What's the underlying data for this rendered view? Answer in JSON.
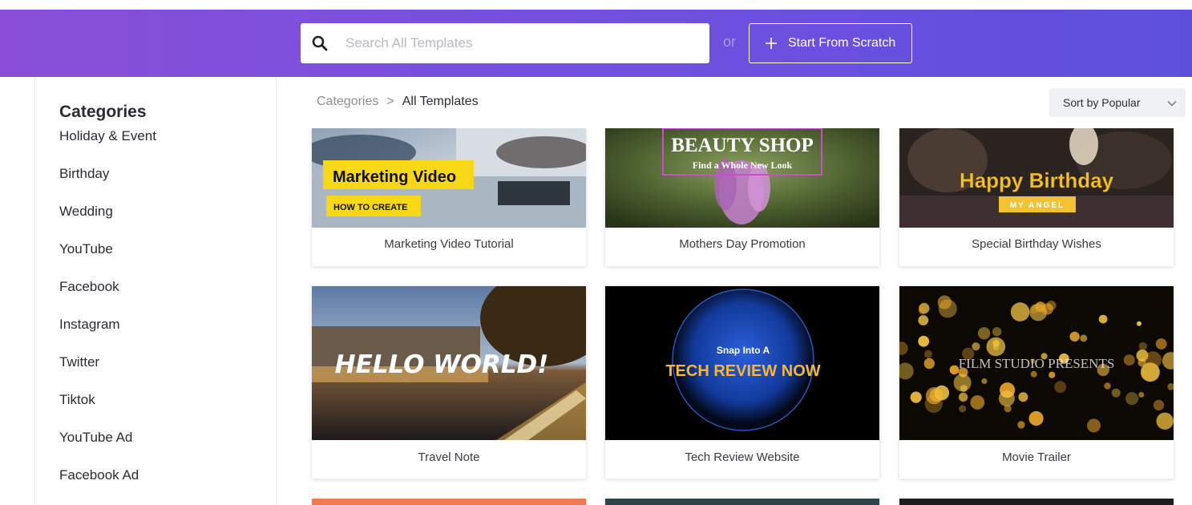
{
  "header": {
    "search": {
      "placeholder": "Search All Templates",
      "value": ""
    },
    "or_text": "or",
    "scratch_button": "Start From Scratch"
  },
  "sidebar": {
    "title": "Categories",
    "items": [
      {
        "label": "Holiday & Event"
      },
      {
        "label": "Birthday"
      },
      {
        "label": "Wedding"
      },
      {
        "label": "YouTube"
      },
      {
        "label": "Facebook"
      },
      {
        "label": "Instagram"
      },
      {
        "label": "Twitter"
      },
      {
        "label": "Tiktok"
      },
      {
        "label": "YouTube Ad"
      },
      {
        "label": "Facebook Ad"
      }
    ]
  },
  "breadcrumb": {
    "root": "Categories",
    "separator": ">",
    "current": "All Templates"
  },
  "sort": {
    "label": "Sort by Popular"
  },
  "templates": [
    {
      "title": "Marketing Video Tutorial",
      "thumb_text": "Marketing Video",
      "thumb_subtext": "HOW TO CREATE"
    },
    {
      "title": "Mothers Day Promotion",
      "thumb_text": "BEAUTY SHOP",
      "thumb_subtext": "Find a Whole New Look"
    },
    {
      "title": "Special Birthday Wishes",
      "thumb_text": "Happy Birthday",
      "thumb_subtext": "MY ANGEL"
    },
    {
      "title": "Travel Note",
      "thumb_text": "HELLO WORLD!"
    },
    {
      "title": "Tech Review Website",
      "thumb_text": "TECH REVIEW NOW",
      "thumb_subtext": "Snap Into A"
    },
    {
      "title": "Movie Trailer",
      "thumb_text": "FILM STUDIO PRESENTS"
    }
  ],
  "colors": {
    "header_gradient_start": "#8a4fd6",
    "header_gradient_end": "#5d4fdc",
    "marketing_yellow": "#f7d816",
    "birthday_gold": "#f2c230"
  }
}
